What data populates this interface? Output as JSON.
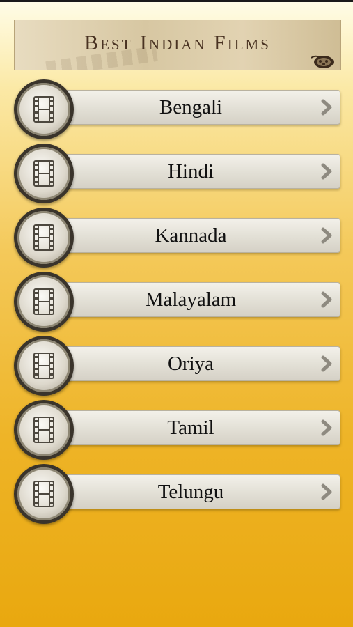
{
  "banner": {
    "title": "Best Indian Films",
    "icon": "film-reel-icon"
  },
  "languages": [
    {
      "label": "Bengali",
      "icon": "film-strip-icon",
      "action": "chevron-right-icon"
    },
    {
      "label": "Hindi",
      "icon": "film-strip-icon",
      "action": "chevron-right-icon"
    },
    {
      "label": "Kannada",
      "icon": "film-strip-icon",
      "action": "chevron-right-icon"
    },
    {
      "label": "Malayalam",
      "icon": "film-strip-icon",
      "action": "chevron-right-icon"
    },
    {
      "label": "Oriya",
      "icon": "film-strip-icon",
      "action": "chevron-right-icon"
    },
    {
      "label": "Tamil",
      "icon": "film-strip-icon",
      "action": "chevron-right-icon"
    },
    {
      "label": "Telungu",
      "icon": "film-strip-icon",
      "action": "chevron-right-icon"
    }
  ],
  "colors": {
    "background_top": "#fffde8",
    "background_bottom": "#e9a80f",
    "button": "#e2dfd5",
    "ring": "#3a342b"
  }
}
